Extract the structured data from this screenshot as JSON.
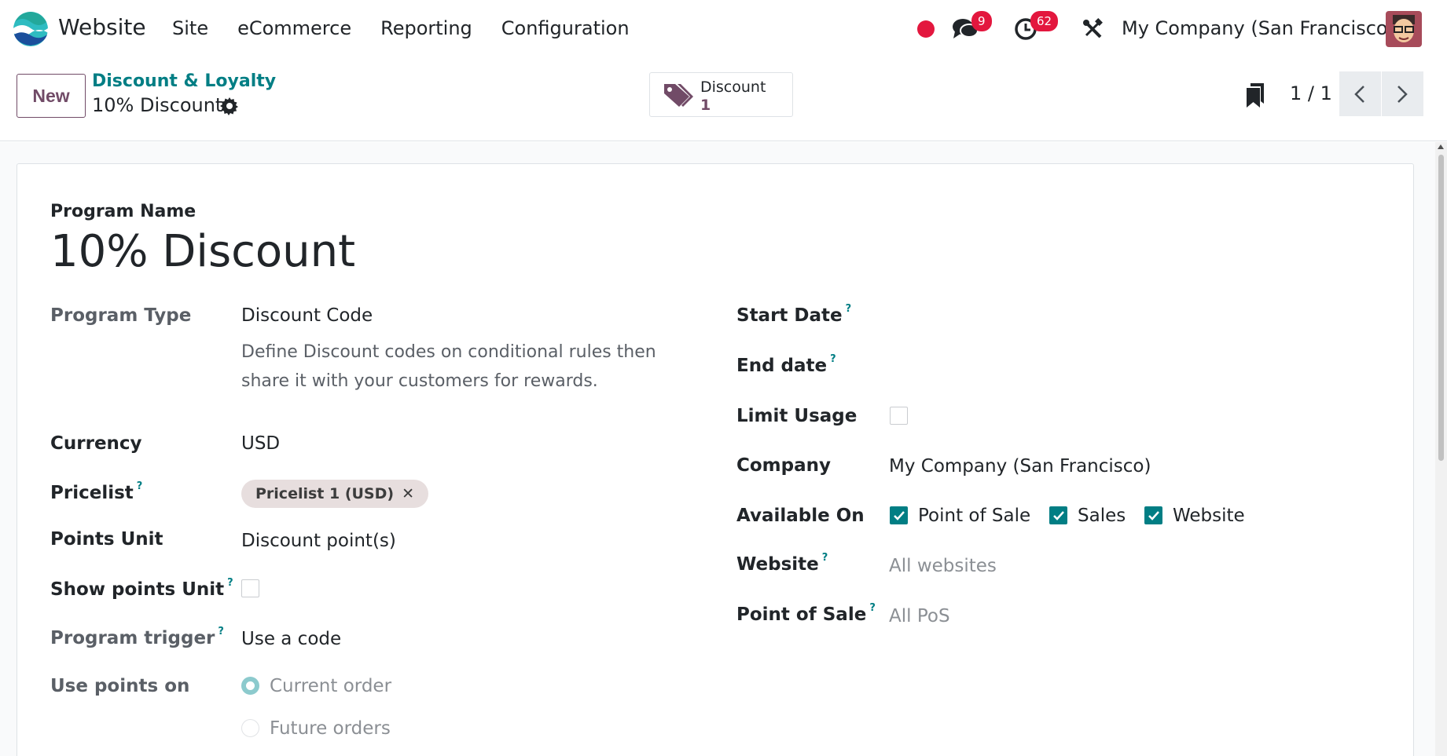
{
  "navbar": {
    "app_name": "Website",
    "menu": [
      "Site",
      "eCommerce",
      "Reporting",
      "Configuration"
    ],
    "messages_count": "9",
    "activities_count": "62",
    "company": "My Company (San Francisco)"
  },
  "control_panel": {
    "new_label": "New",
    "breadcrumb_parent": "Discount & Loyalty",
    "breadcrumb_current": "10% Discount",
    "smart_button": {
      "label": "Discount",
      "count": "1"
    },
    "pager": "1 / 1"
  },
  "form": {
    "program_name_label": "Program Name",
    "program_name": "10% Discount",
    "left": {
      "program_type_label": "Program Type",
      "program_type": "Discount Code",
      "program_type_desc": "Define Discount codes on conditional rules then share it with your customers for rewards.",
      "currency_label": "Currency",
      "currency": "USD",
      "pricelist_label": "Pricelist",
      "pricelist_tag": "Pricelist 1 (USD)",
      "points_unit_label": "Points Unit",
      "points_unit": "Discount point(s)",
      "show_points_unit_label": "Show points Unit",
      "show_points_unit_checked": false,
      "program_trigger_label": "Program trigger",
      "program_trigger": "Use a code",
      "use_points_on_label": "Use points on",
      "use_points_options": [
        {
          "label": "Current order",
          "selected": true
        },
        {
          "label": "Future orders",
          "selected": false
        }
      ]
    },
    "right": {
      "start_date_label": "Start Date",
      "end_date_label": "End date",
      "limit_usage_label": "Limit Usage",
      "limit_usage_checked": false,
      "company_label": "Company",
      "company": "My Company (San Francisco)",
      "available_on_label": "Available On",
      "available_on": [
        {
          "label": "Point of Sale",
          "checked": true
        },
        {
          "label": "Sales",
          "checked": true
        },
        {
          "label": "Website",
          "checked": true
        }
      ],
      "website_label": "Website",
      "website_placeholder": "All websites",
      "pos_label": "Point of Sale",
      "pos_placeholder": "All PoS"
    }
  },
  "colors": {
    "brand": "#714b67",
    "accent": "#017e84",
    "badge": "#e3173e"
  }
}
